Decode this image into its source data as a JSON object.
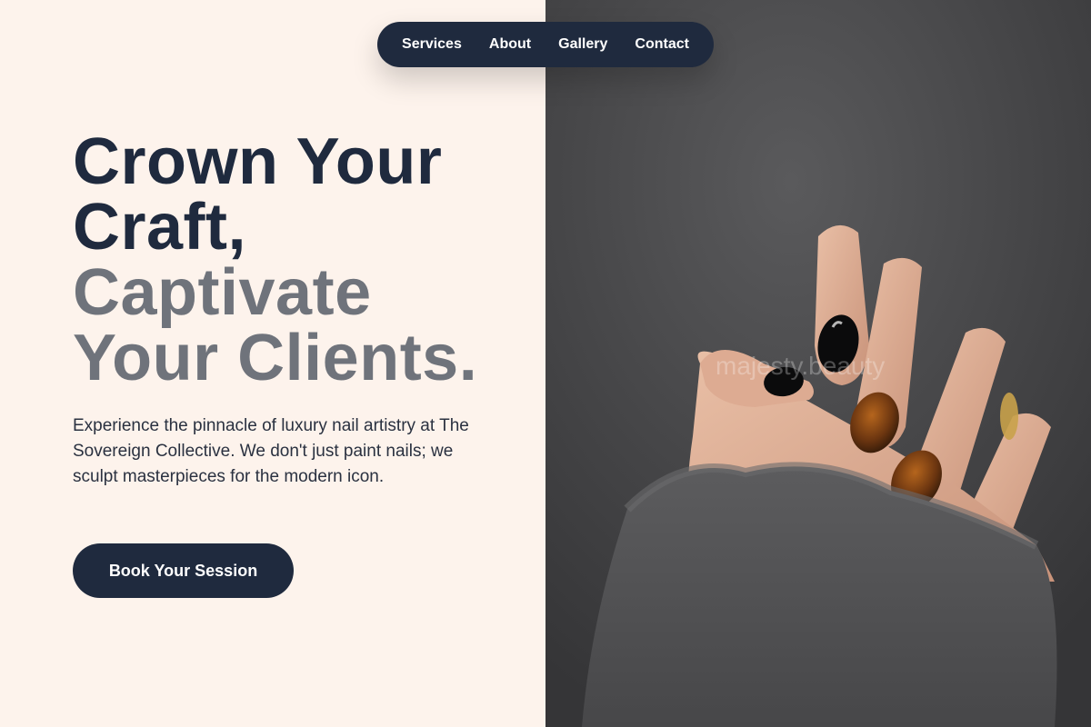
{
  "nav": {
    "items": [
      {
        "label": "Services"
      },
      {
        "label": "About"
      },
      {
        "label": "Gallery"
      },
      {
        "label": "Contact"
      }
    ]
  },
  "hero": {
    "headline_line1": "Crown Your",
    "headline_line2": "Craft,",
    "headline_line3": "Captivate",
    "headline_line4": "Your Clients.",
    "description": "Experience the pinnacle of luxury nail artistry at The Sovereign Collective. We don't just paint nails; we sculpt masterpieces for the modern icon.",
    "cta_label": "Book Your Session"
  },
  "image": {
    "watermark": "majesty.beauty",
    "subject": "hand-with-manicure-photo"
  },
  "colors": {
    "navy": "#1f2a3e",
    "gray_text": "#6f737b",
    "cream_bg": "#fdf3ec",
    "photo_bg": "#3e3e40"
  }
}
